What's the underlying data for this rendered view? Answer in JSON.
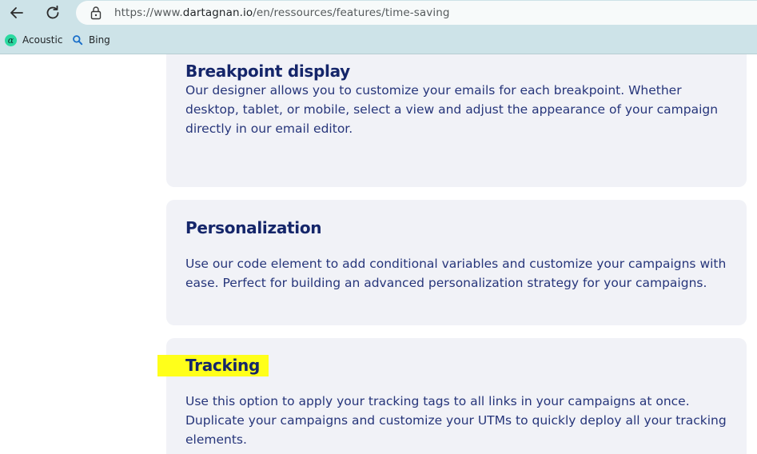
{
  "browser": {
    "url_prefix": "https://www.",
    "url_host": "dartagnan.io",
    "url_path": "/en/ressources/features/time-saving",
    "bookmarks": [
      {
        "label": "Acoustic",
        "icon": "acoustic-logo-icon"
      },
      {
        "label": "Bing",
        "icon": "search-icon"
      }
    ]
  },
  "features": [
    {
      "title": "Breakpoint display",
      "description": "Our designer allows you to customize your emails for each breakpoint. Whether desktop, tablet, or mobile, select a view and adjust the appearance of your campaign directly in our email editor."
    },
    {
      "title": "Personalization",
      "description": "Use our code element to add conditional variables and customize your campaigns with ease. Perfect for building an advanced personalization strategy for your campaigns."
    },
    {
      "title": "Tracking",
      "description": "Use this option to apply your tracking tags to all links in your campaigns at once. Duplicate your campaigns and customize your UTMs to quickly deploy all your tracking elements.",
      "highlighted": true
    }
  ],
  "colors": {
    "title": "#15266a",
    "text": "#26357a",
    "card_bg": "#f1f2f7",
    "highlight": "#ffff1a",
    "chrome_bg": "#cde3e8"
  }
}
